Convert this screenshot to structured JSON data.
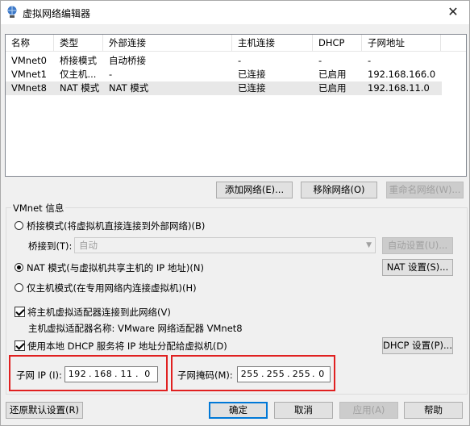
{
  "window": {
    "title": "虚拟网络编辑器",
    "close_glyph": "✕"
  },
  "table": {
    "columns": [
      "名称",
      "类型",
      "外部连接",
      "主机连接",
      "DHCP",
      "子网地址"
    ],
    "rows": [
      [
        "VMnet0",
        "桥接模式",
        "自动桥接",
        "-",
        "-",
        "-"
      ],
      [
        "VMnet1",
        "仅主机...",
        "-",
        "已连接",
        "已启用",
        "192.168.166.0"
      ],
      [
        "VMnet8",
        "NAT 模式",
        "NAT 模式",
        "已连接",
        "已启用",
        "192.168.11.0"
      ]
    ],
    "selected_row": 2
  },
  "network_buttons": {
    "add": "添加网络(E)...",
    "remove": "移除网络(O)",
    "rename": "重命名网络(W)..."
  },
  "vmnet_info": {
    "group_label": "VMnet 信息",
    "bridge_mode": "桥接模式(将虚拟机直接连接到外部网络)(B)",
    "bridge_to_label": "桥接到(T):",
    "bridge_to_value": "自动",
    "auto_settings": "自动设置(U)...",
    "nat_mode": "NAT 模式(与虚拟机共享主机的 IP 地址)(N)",
    "nat_settings": "NAT 设置(S)...",
    "host_only": "仅主机模式(在专用网络内连接虚拟机)(H)",
    "connect_adapter": "将主机虚拟适配器连接到此网络(V)",
    "adapter_name": "主机虚拟适配器名称: VMware 网络适配器 VMnet8",
    "use_dhcp": "使用本地 DHCP 服务将 IP 地址分配给虚拟机(D)",
    "dhcp_settings": "DHCP 设置(P)...",
    "subnet_ip_label": "子网 IP (I):",
    "subnet_ip": [
      "192",
      "168",
      "11",
      "0"
    ],
    "subnet_mask_label": "子网掩码(M):",
    "subnet_mask": [
      "255",
      "255",
      "255",
      "0"
    ],
    "selected_mode": "nat",
    "connect_adapter_checked": true,
    "use_dhcp_checked": true
  },
  "footer": {
    "restore": "还原默认设置(R)",
    "ok": "确定",
    "cancel": "取消",
    "apply": "应用(A)",
    "help": "帮助"
  },
  "colors": {
    "highlight": "#e02020",
    "accent": "#0078d7"
  }
}
